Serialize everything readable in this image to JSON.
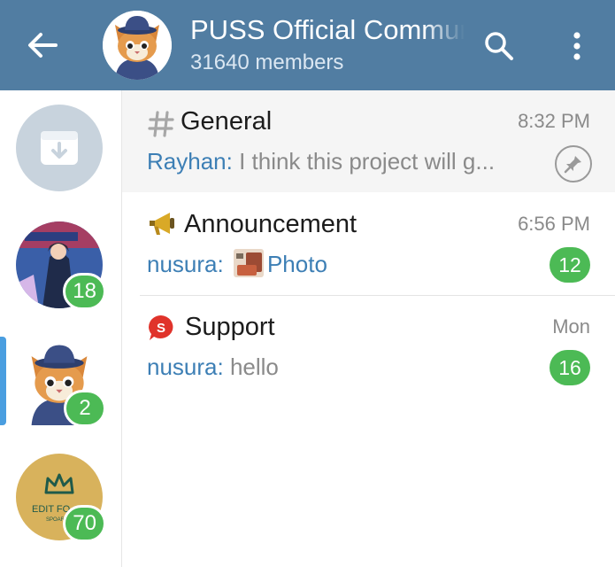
{
  "header": {
    "title": "PUSS Official Community",
    "subtitle": "31640 members",
    "icons": {
      "back": "arrow-back-icon",
      "search": "search-icon",
      "more": "more-vertical-icon"
    }
  },
  "sidebar": {
    "items": [
      {
        "kind": "archive",
        "icon": "archive-icon"
      },
      {
        "kind": "chat",
        "badge": "18"
      },
      {
        "kind": "chat",
        "badge": "2",
        "active": true
      },
      {
        "kind": "chat",
        "badge": "70",
        "logo_text": "EDIT FO",
        "logo_subtext": "SPOAR"
      }
    ]
  },
  "topics": [
    {
      "title": "General",
      "time": "8:32 PM",
      "sender": "Rayhan:",
      "preview": " I think this project will g...",
      "pinned": true,
      "icon": "hash-icon"
    },
    {
      "title": "Announcement",
      "time": "6:56 PM",
      "sender": "nusura:",
      "preview": "Photo",
      "count": "12",
      "icon": "megaphone-icon"
    },
    {
      "title": "Support",
      "time": "Mon",
      "sender": "nusura:",
      "preview": " hello",
      "count": "16",
      "icon": "support-s-icon",
      "icon_letter": "S"
    }
  ],
  "colors": {
    "header_bg": "#517da2",
    "badge_green": "#4cba55",
    "sender_blue": "#3d7fb5",
    "active_indicator": "#4a9ee0"
  }
}
